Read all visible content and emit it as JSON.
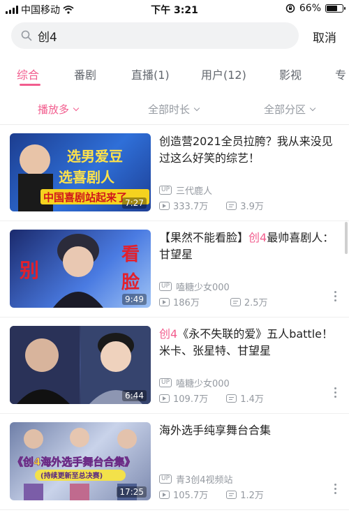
{
  "status_bar": {
    "carrier": "中国移动",
    "time": "下午 3:21",
    "battery": "66%",
    "battery_level": 0.66
  },
  "search": {
    "query": "创4",
    "cancel_label": "取消"
  },
  "tabs": [
    {
      "label": "综合"
    },
    {
      "label": "番剧"
    },
    {
      "label": "直播(1)"
    },
    {
      "label": "用户(12)"
    },
    {
      "label": "影视"
    },
    {
      "label": "专"
    }
  ],
  "filters": [
    {
      "label": "播放多"
    },
    {
      "label": "全部时长"
    },
    {
      "label": "全部分区"
    }
  ],
  "items": [
    {
      "title_pre": "创造营2021全员拉胯？我从来没见过这么好笑的综艺！",
      "title_hl": "",
      "title_post": "",
      "uploader": "三代鹿人",
      "views": "333.7万",
      "danmaku": "3.9万",
      "duration": "7:27",
      "thumb_text": [
        "选男爱豆",
        "选喜剧人",
        "中国喜剧站起来了"
      ]
    },
    {
      "title_pre": "【果然不能看脸】",
      "title_hl": "创4",
      "title_post": "最帅喜剧人：甘望星",
      "uploader": "嗑糖少女000",
      "views": "186万",
      "danmaku": "2.5万",
      "duration": "9:49",
      "thumb_text": [
        "别",
        "看",
        "脸"
      ]
    },
    {
      "title_pre": "",
      "title_hl": "创4",
      "title_post": "《永不失联的爱》五人battle！米卡、张星特、甘望星",
      "uploader": "嗑糖少女000",
      "views": "109.7万",
      "danmaku": "1.4万",
      "duration": "6:44",
      "thumb_text": []
    },
    {
      "title_pre": "海外选手纯享舞台合集",
      "title_hl": "",
      "title_post": "",
      "uploader": "青3创4视频站",
      "views": "105.7万",
      "danmaku": "1.2万",
      "duration": "17:25",
      "thumb_text": [
        "《创4海外选手舞台合集》",
        "(持续更新至总决赛)"
      ]
    }
  ],
  "badges": {
    "up": "UP"
  },
  "colors": {
    "accent": "#f25d8e",
    "muted": "#9499a0"
  }
}
